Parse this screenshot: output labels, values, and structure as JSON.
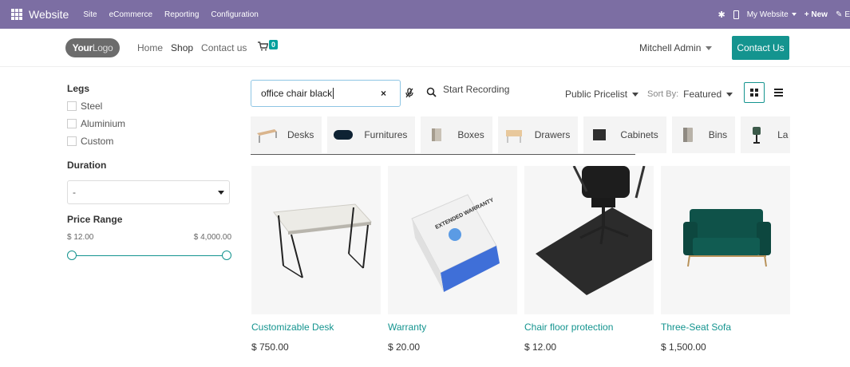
{
  "adminbar": {
    "brand": "Website",
    "menus": [
      "Site",
      "eCommerce",
      "Reporting",
      "Configuration"
    ],
    "my_website": "My Website",
    "new_label": "+ New",
    "edit_label": "E"
  },
  "header": {
    "logo": {
      "bold": "Your",
      "rest": "Logo"
    },
    "nav": [
      "Home",
      "Shop",
      "Contact us"
    ],
    "cart_count": "0",
    "user": "Mitchell Admin",
    "contact_button": "Contact Us"
  },
  "sidebar": {
    "legs_title": "Legs",
    "legs_options": [
      "Steel",
      "Aluminium",
      "Custom"
    ],
    "duration_title": "Duration",
    "duration_value": "-",
    "price_title": "Price Range",
    "price_min": "$ 12.00",
    "price_max": "$ 4,000.00"
  },
  "toolbar": {
    "search_value": "office chair black",
    "clear": "×",
    "recording": "Start Recording",
    "pricelist": "Public Pricelist",
    "sort_label": "Sort By:",
    "sort_value": "Featured"
  },
  "categories": [
    "Desks",
    "Furnitures",
    "Boxes",
    "Drawers",
    "Cabinets",
    "Bins",
    "La"
  ],
  "products": [
    {
      "name": "Customizable Desk",
      "price": "$ 750.00"
    },
    {
      "name": "Warranty",
      "price": "$ 20.00"
    },
    {
      "name": "Chair floor protection",
      "price": "$ 12.00"
    },
    {
      "name": "Three-Seat Sofa",
      "price": "$ 1,500.00"
    }
  ],
  "warranty_box_text": "EXTENDED WARRANTY",
  "colors": {
    "admin": "#7c6ea3",
    "accent": "#14948f",
    "search_border": "#8ec5e4"
  }
}
